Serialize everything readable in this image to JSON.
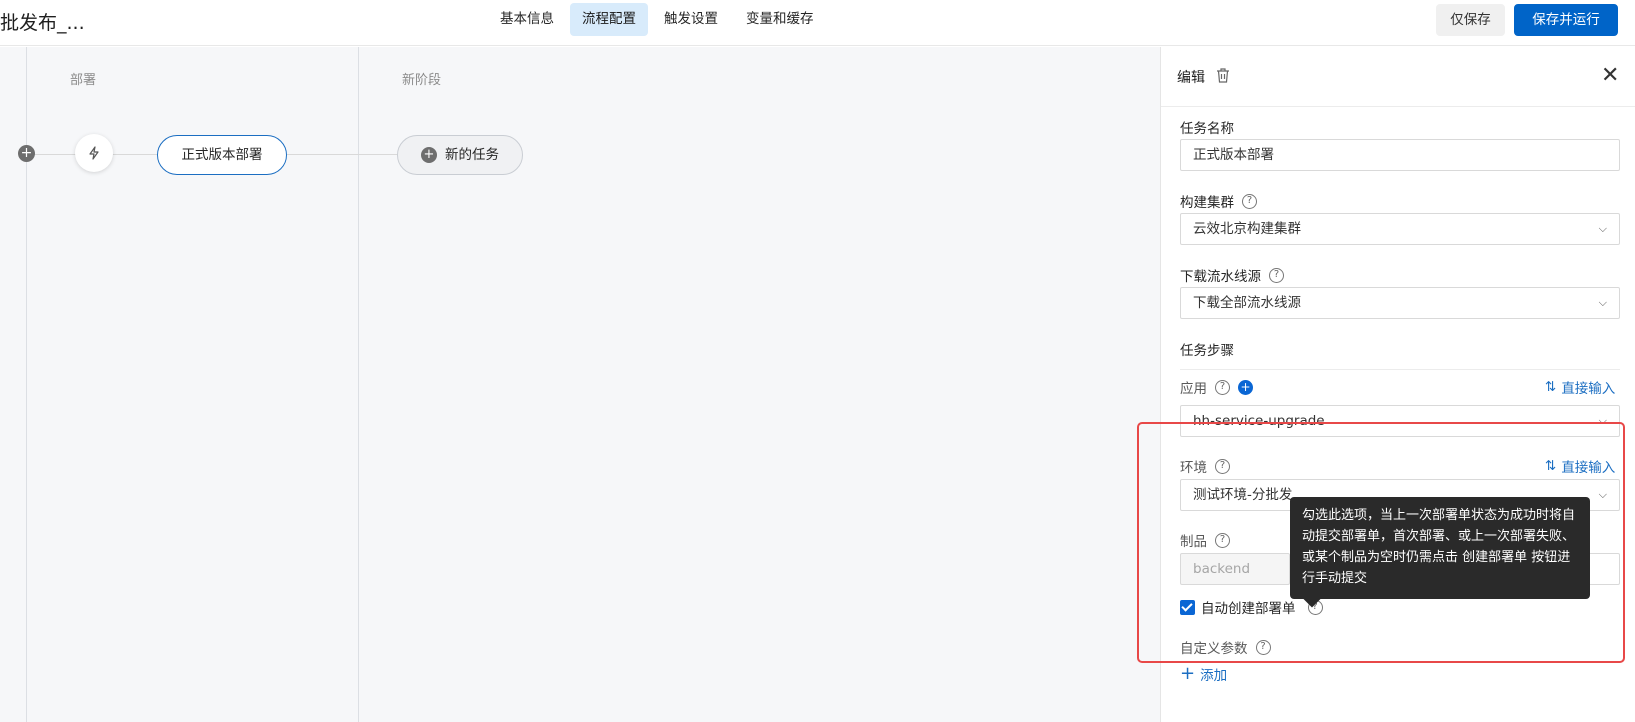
{
  "header": {
    "title": "批发布_...",
    "tabs": [
      "基本信息",
      "流程配置",
      "触发设置",
      "变量和缓存"
    ],
    "save_only": "仅保存",
    "save_run": "保存并运行"
  },
  "canvas": {
    "stages": [
      "部署",
      "新阶段"
    ],
    "task_node": "正式版本部署",
    "new_task": "新的任务"
  },
  "panel": {
    "title": "编辑",
    "task_name_label": "任务名称",
    "task_name_value": "正式版本部署",
    "cluster_label": "构建集群",
    "cluster_value": "云效北京构建集群",
    "source_label": "下载流水线源",
    "source_value": "下载全部流水线源",
    "steps_label": "任务步骤",
    "app_label": "应用",
    "direct_input": "直接输入",
    "app_value": "hh-service-upgrade",
    "env_label": "环境",
    "env_value": "测试环境-分批发",
    "artifact_label": "制品",
    "artifact_value": "backend",
    "auto_create_label": "自动创建部署单",
    "tooltip": "勾选此选项，当上一次部署单状态为成功时将自动提交部署单，首次部署、或上一次部署失败、或某个制品为空时仍需点击 创建部署单 按钮进行手动提交",
    "custom_params_label": "自定义参数",
    "add_label": "添加"
  },
  "colors": {
    "accent": "#0064c8",
    "highlight_box": "#e84848"
  }
}
